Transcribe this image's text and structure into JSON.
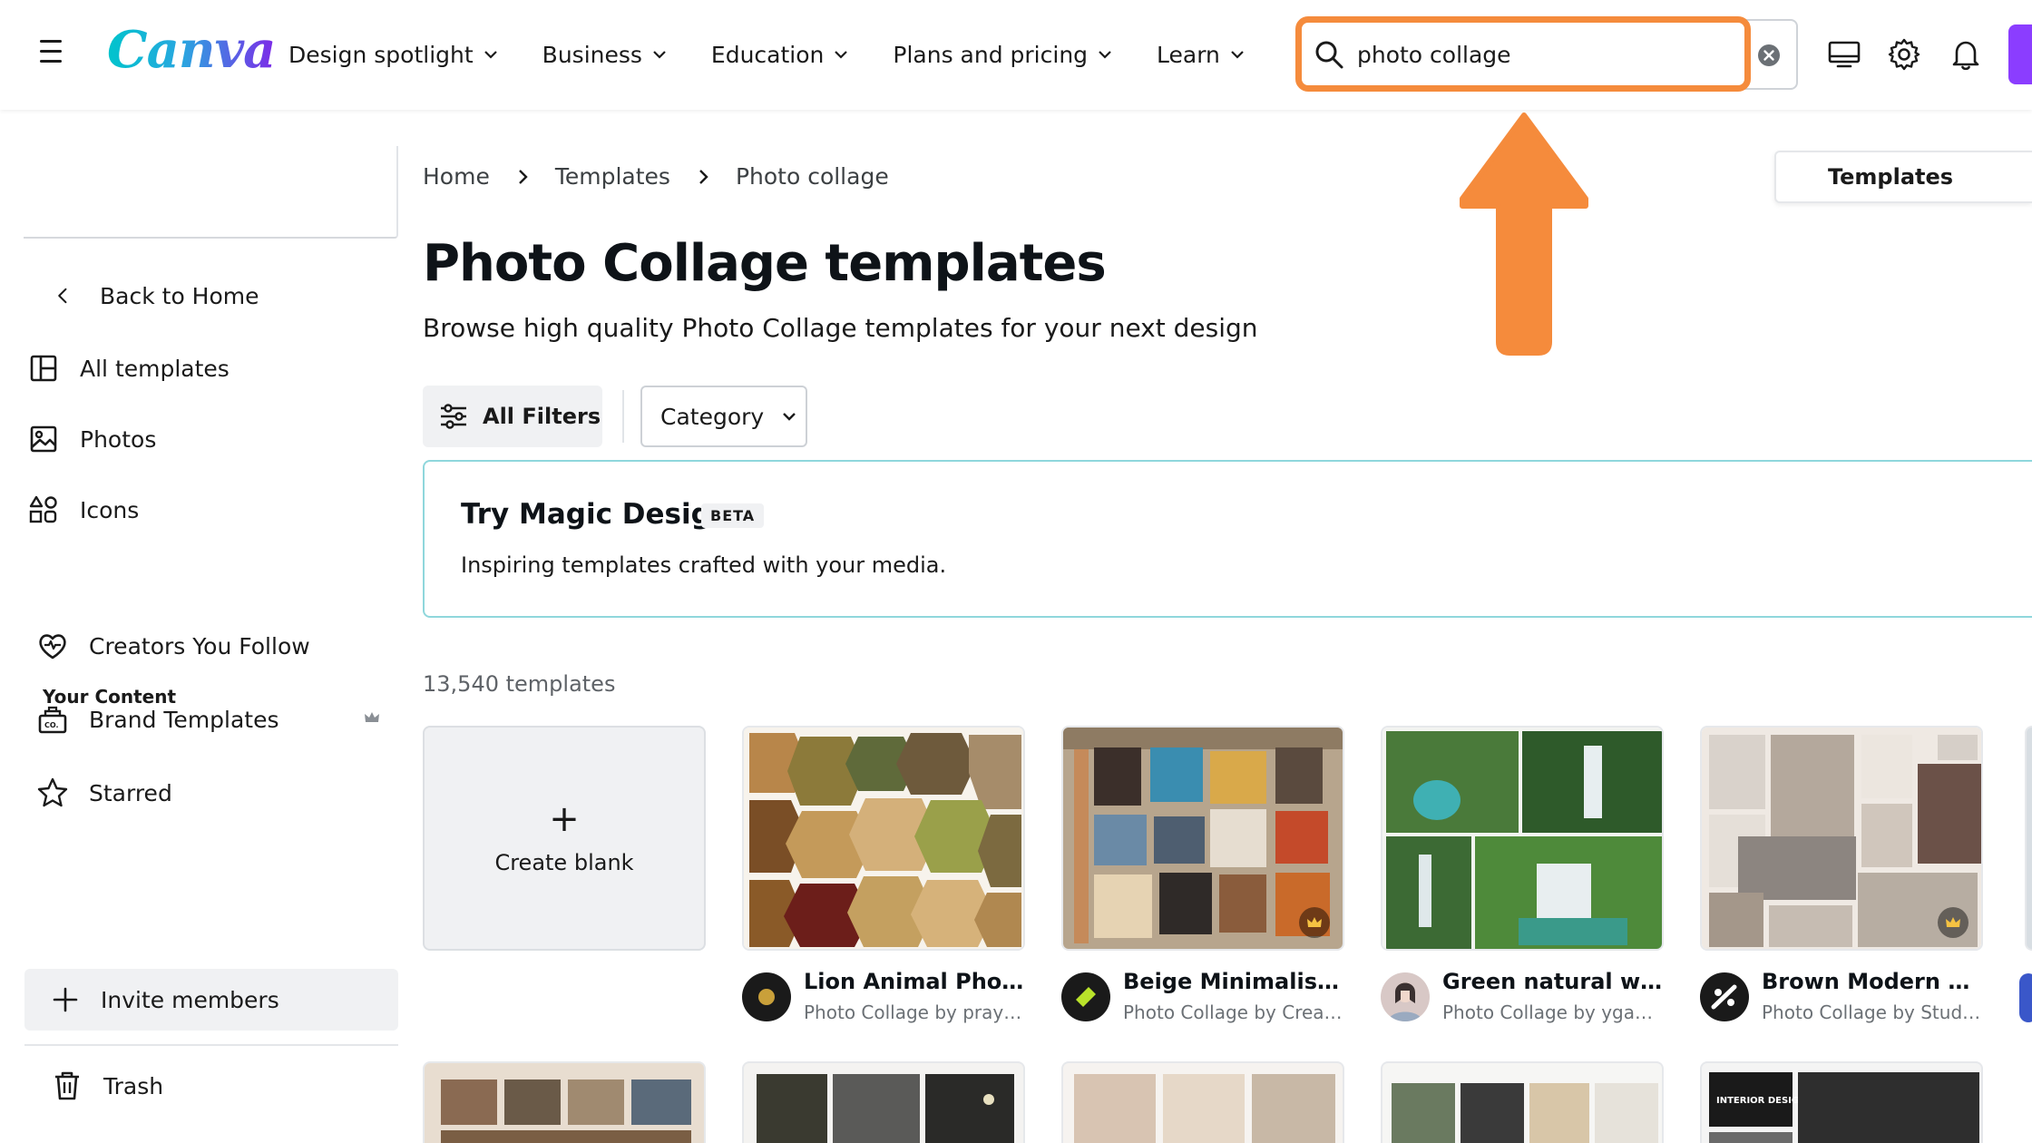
{
  "header": {
    "logo_text": "Canva",
    "nav": [
      {
        "label": "Design spotlight"
      },
      {
        "label": "Business"
      },
      {
        "label": "Education"
      },
      {
        "label": "Plans and pricing"
      },
      {
        "label": "Learn"
      }
    ],
    "search_value": "photo collage",
    "accent_color": "#8b3dff",
    "highlight_color": "#f58b3c"
  },
  "sidebar": {
    "back_label": "Back to Home",
    "items": [
      {
        "label": "All templates",
        "icon": "layout-icon"
      },
      {
        "label": "Photos",
        "icon": "image-icon"
      },
      {
        "label": "Icons",
        "icon": "shapes-icon"
      }
    ],
    "section_heading": "Your Content",
    "content_items": [
      {
        "label": "Creators You Follow",
        "icon": "heart-icon"
      },
      {
        "label": "Brand Templates",
        "icon": "brand-kit-icon"
      },
      {
        "label": "Starred",
        "icon": "star-icon"
      }
    ],
    "invite_label": "Invite members",
    "trash_label": "Trash"
  },
  "breadcrumb": [
    "Home",
    "Templates",
    "Photo collage"
  ],
  "tab_label": "Templates",
  "page": {
    "title": "Photo Collage templates",
    "subtitle": "Browse high quality Photo Collage templates for your next design"
  },
  "filters": {
    "all_filters_label": "All Filters",
    "category_label": "Category"
  },
  "magic_design": {
    "title": "Try Magic Design",
    "badge": "BETA",
    "subtitle": "Inspiring templates crafted with your media."
  },
  "results_count": "13,540 templates",
  "create_blank_label": "Create blank",
  "templates": [
    {
      "title": "Lion Animal Photo ...",
      "author": "Photo Collage by prayo..."
    },
    {
      "title": "Beige Minimalist S...",
      "author": "Photo Collage by Creati..."
    },
    {
      "title": "Green natural wate...",
      "author": "Photo Collage by yganko"
    },
    {
      "title": "Brown Modern Clea...",
      "author": "Photo Collage by Studi..."
    }
  ]
}
